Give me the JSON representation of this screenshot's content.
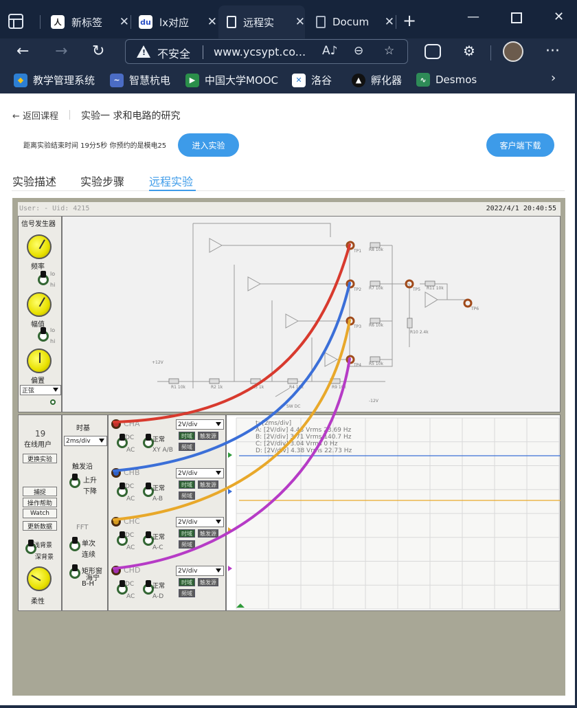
{
  "browser": {
    "tabs": [
      {
        "label": "新标签",
        "active": false
      },
      {
        "label": "lx对应",
        "active": false
      },
      {
        "label": "远程实",
        "active": true
      },
      {
        "label": "Docum",
        "active": false
      }
    ],
    "insecure_label": "不安全",
    "url": "www.ycsypt.co..."
  },
  "bookmarks": [
    "教学管理系统",
    "智慧杭电",
    "中国大学MOOC",
    "洛谷",
    "孵化器",
    "Desmos"
  ],
  "page": {
    "back_label": "返回课程",
    "title": "实验一 求和电路的研究",
    "countdown": "距离实验结束时间 19分5秒 你预约的是模电25",
    "enter_button": "进入实验",
    "client_button": "客户端下载",
    "tabs": [
      "实验描述",
      "实验步骤",
      "远程实验"
    ],
    "active_tab": "远程实验"
  },
  "lab": {
    "user": "User: - Uid: 4215",
    "datetime": "2022/4/1 20:40:55",
    "siggen": {
      "title": "信号发生器",
      "freq": "频率",
      "amp": "幅值",
      "offset": "偏置",
      "lo": "lo",
      "hi": "hi",
      "waveform": "正弦"
    },
    "users": {
      "count": "19",
      "online": "在线用户",
      "switch": "更换实验",
      "capture": "捕捉",
      "help": "操作帮助",
      "watch": "Watch",
      "update": "更新数据",
      "light_bg": "浅背景",
      "dark_bg": "深背景",
      "soft": "柔性"
    },
    "timebase": {
      "title": "时基",
      "value": "2ms/div",
      "trigger": "触发沿",
      "rise": "上升",
      "fall": "下降",
      "fft": "FFT",
      "single": "单次",
      "continuous": "连续",
      "rect_window": "矩形窗",
      "hanning": "海宁",
      "bh": "B-H"
    },
    "channels": [
      {
        "name": "CHA",
        "div": "2V/div",
        "dc": "DC",
        "ac": "AC",
        "normal": "正常",
        "mode": "XY A/B",
        "color": "#d83a2e",
        "jack_color": "#c0302a"
      },
      {
        "name": "CHB",
        "div": "2V/div",
        "dc": "DC",
        "ac": "AC",
        "normal": "正常",
        "mode": "A-B",
        "color": "#3b6fd8",
        "jack_color": "#2f5fc4"
      },
      {
        "name": "CHC",
        "div": "2V/div",
        "dc": "DC",
        "ac": "AC",
        "normal": "正常",
        "mode": "A-C",
        "color": "#e8a82a",
        "jack_color": "#d49a20"
      },
      {
        "name": "CHD",
        "div": "2V/div",
        "dc": "DC",
        "ac": "AC",
        "normal": "正常",
        "mode": "A-D",
        "color": "#b63bc6",
        "jack_color": "#a230b0"
      }
    ],
    "channel_buttons": {
      "time": "时域",
      "trigger_src": "触发源",
      "freq": "频域"
    },
    "scope_readout": [
      "t: [2ms/div]",
      "A: [2V/div] 4.48 Vrms  23.69 Hz",
      "B: [2V/div] 3.71 Vrms  140.7 Hz",
      "C: [2V/div] 3.04 Vrms  0 Hz",
      "D: [2V/div] 4.38 Vrms  22.73 Hz"
    ],
    "circuit_labels": {
      "tp1": "TP1",
      "tp2": "TP2",
      "tp3": "TP3",
      "tp4": "TP4",
      "tp5": "TP5",
      "tp6": "TP6",
      "r8": "R8 10k",
      "r7": "R7 10k",
      "r6": "R6 10k",
      "r5": "R5 10k",
      "r11": "R11 10k",
      "r10": "R10 2.4k",
      "r1": "R1 10k",
      "r2": "R2 1k",
      "r3": "R3 1k",
      "r4": "R4 10k",
      "r9": "R9 10k",
      "vplus": "+12V",
      "vminus": "-12V",
      "sw": "SW DC"
    }
  },
  "colors": {
    "accent": "#3d9be9",
    "trace_b": "#3b6fd8",
    "trace_c": "#e8a82a",
    "knob": "#e8e000"
  }
}
